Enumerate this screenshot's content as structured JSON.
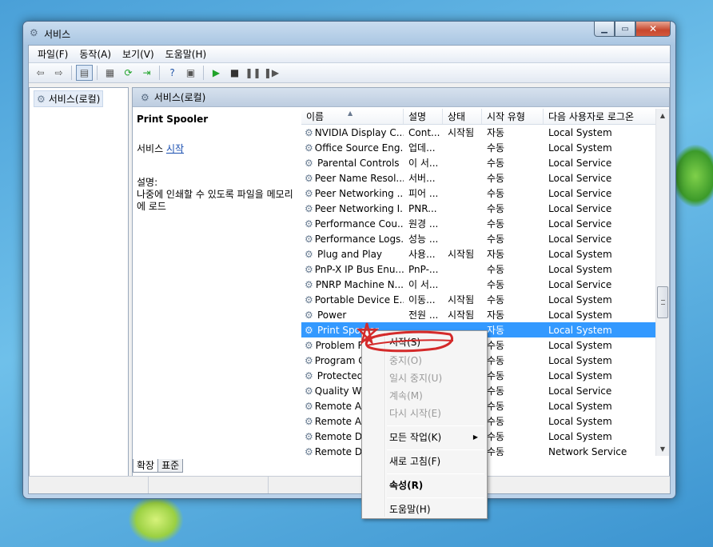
{
  "window": {
    "title": "서비스"
  },
  "menu": [
    "파일(F)",
    "동작(A)",
    "보기(V)",
    "도움말(H)"
  ],
  "tree": {
    "root_label": "서비스(로컬)"
  },
  "pane": {
    "header": "서비스(로컬)",
    "selected_service": "Print Spooler",
    "action_prefix": "서비스 ",
    "action_link": "시작",
    "desc_label": "설명:",
    "desc_text": "나중에 인쇄할 수 있도록 파일을 메모리에 로드"
  },
  "columns": {
    "name": "이름",
    "desc": "설명",
    "state": "상태",
    "start": "시작 유형",
    "logon": "다음 사용자로 로그온"
  },
  "services": [
    {
      "name": "NVIDIA Display C...",
      "desc": "Cont...",
      "state": "시작됨",
      "start": "자동",
      "logon": "Local System"
    },
    {
      "name": "Office Source Eng...",
      "desc": "업데...",
      "state": "",
      "start": "수동",
      "logon": "Local System"
    },
    {
      "name": "Parental Controls",
      "desc": "이 서...",
      "state": "",
      "start": "수동",
      "logon": "Local Service"
    },
    {
      "name": "Peer Name Resol...",
      "desc": "서버...",
      "state": "",
      "start": "수동",
      "logon": "Local Service"
    },
    {
      "name": "Peer Networking ...",
      "desc": "피어 ...",
      "state": "",
      "start": "수동",
      "logon": "Local Service"
    },
    {
      "name": "Peer Networking I...",
      "desc": "PNR...",
      "state": "",
      "start": "수동",
      "logon": "Local Service"
    },
    {
      "name": "Performance Cou...",
      "desc": "원경 ...",
      "state": "",
      "start": "수동",
      "logon": "Local Service"
    },
    {
      "name": "Performance Logs...",
      "desc": "성능 ...",
      "state": "",
      "start": "수동",
      "logon": "Local Service"
    },
    {
      "name": "Plug and Play",
      "desc": "사용...",
      "state": "시작됨",
      "start": "자동",
      "logon": "Local System"
    },
    {
      "name": "PnP-X IP Bus Enu...",
      "desc": "PnP-...",
      "state": "",
      "start": "수동",
      "logon": "Local System"
    },
    {
      "name": "PNRP Machine N...",
      "desc": "이 서...",
      "state": "",
      "start": "수동",
      "logon": "Local Service"
    },
    {
      "name": "Portable Device E...",
      "desc": "이동...",
      "state": "시작됨",
      "start": "수동",
      "logon": "Local System"
    },
    {
      "name": "Power",
      "desc": "전원 ...",
      "state": "시작됨",
      "start": "자동",
      "logon": "Local System"
    },
    {
      "name": "Print Spooler",
      "desc": "",
      "state": "",
      "start": "자동",
      "logon": "Local System",
      "selected": true
    },
    {
      "name": "Problem Reports...",
      "desc": "",
      "state": "",
      "start": "수동",
      "logon": "Local System"
    },
    {
      "name": "Program Compat...",
      "desc": "",
      "state": "",
      "start": "수동",
      "logon": "Local System"
    },
    {
      "name": "Protected Storage",
      "desc": "",
      "state": "",
      "start": "수동",
      "logon": "Local System"
    },
    {
      "name": "Quality Windows...",
      "desc": "",
      "state": "",
      "start": "수동",
      "logon": "Local Service"
    },
    {
      "name": "Remote Access A...",
      "desc": "",
      "state": "",
      "start": "수동",
      "logon": "Local System"
    },
    {
      "name": "Remote Access C...",
      "desc": "",
      "state": "",
      "start": "수동",
      "logon": "Local System"
    },
    {
      "name": "Remote Desktop C...",
      "desc": "",
      "state": "",
      "start": "수동",
      "logon": "Local System"
    },
    {
      "name": "Remote Desktop S...",
      "desc": "",
      "state": "",
      "start": "수동",
      "logon": "Network Service"
    }
  ],
  "tabs": [
    "확장",
    "표준"
  ],
  "context_menu": {
    "start": "시작(S)",
    "stop": "중지(O)",
    "pause": "일시 중지(U)",
    "resume": "계속(M)",
    "restart": "다시 시작(E)",
    "all_tasks": "모든 작업(K)",
    "refresh": "새로 고침(F)",
    "properties": "속성(R)",
    "help": "도움말(H)"
  },
  "colors": {
    "selection": "#3399ff",
    "annotation": "#d42a2a",
    "link": "#1a4fb0"
  },
  "icons": [
    "services-icon",
    "back-icon",
    "forward-icon",
    "console-tree-icon",
    "properties-icon",
    "refresh-icon",
    "export-icon",
    "help-icon",
    "play-icon",
    "stop-icon",
    "pause-icon",
    "resume-icon",
    "gear-icon"
  ]
}
